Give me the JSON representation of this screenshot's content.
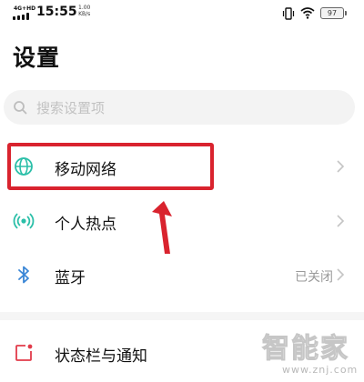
{
  "status_bar": {
    "network": "4G+HD",
    "time": "15:55",
    "speed_value": "1.00",
    "speed_unit": "KB/s",
    "battery": "97",
    "icons": [
      "signal-icon",
      "vibrate-icon",
      "wifi-icon",
      "battery-icon"
    ]
  },
  "page": {
    "title": "设置"
  },
  "search": {
    "placeholder": "搜索设置项"
  },
  "settings": [
    {
      "label": "移动网络",
      "icon": "globe-icon",
      "value": ""
    },
    {
      "label": "个人热点",
      "icon": "hotspot-icon",
      "value": ""
    },
    {
      "label": "蓝牙",
      "icon": "bluetooth-icon",
      "value": "已关闭"
    },
    {
      "label": "状态栏与通知",
      "icon": "notification-icon",
      "value": ""
    }
  ],
  "watermark": {
    "text": "智能家",
    "url": "www.znj.com"
  },
  "colors": {
    "accent": "#2bbfa8",
    "highlight": "#d9232e",
    "bluetooth": "#3a86d6",
    "notification": "#e23b4a"
  }
}
